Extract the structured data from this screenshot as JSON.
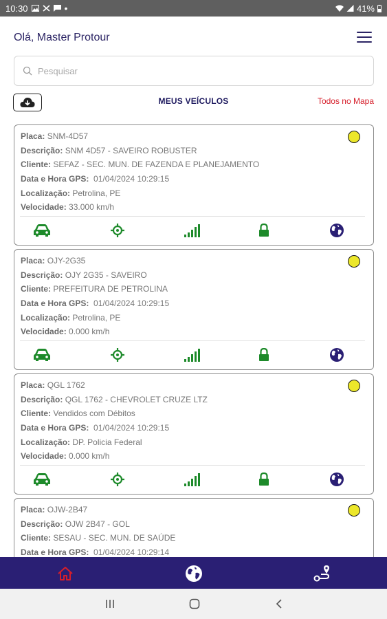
{
  "status_bar": {
    "time": "10:30",
    "battery": "41%"
  },
  "header": {
    "greeting": "Olá, Master Protour"
  },
  "search": {
    "placeholder": "Pesquisar"
  },
  "section": {
    "title": "MEUS VEÍCULOS",
    "map_link": "Todos no Mapa"
  },
  "labels": {
    "plate": "Placa:",
    "description": "Descrição:",
    "client": "Cliente:",
    "gps_time": "Data e Hora GPS:",
    "location": "Localização:",
    "speed": "Velocidade:"
  },
  "vehicles": [
    {
      "plate": "SNM-4D57",
      "description": "SNM 4D57 - SAVEIRO ROBUSTER",
      "client": "SEFAZ - SEC. MUN. DE FAZENDA E PLANEJAMENTO",
      "gps_time": "01/04/2024 10:29:15",
      "location": "Petrolina, PE",
      "speed": "33.000 km/h"
    },
    {
      "plate": "OJY-2G35",
      "description": "OJY 2G35 - SAVEIRO",
      "client": "PREFEITURA DE PETROLINA",
      "gps_time": "01/04/2024 10:29:15",
      "location": "Petrolina, PE",
      "speed": "0.000 km/h"
    },
    {
      "plate": "QGL 1762",
      "description": "QGL 1762 - CHEVROLET CRUZE LTZ",
      "client": "Vendidos com Débitos",
      "gps_time": "01/04/2024 10:29:15",
      "location": "DP. Policia Federal",
      "speed": "0.000 km/h"
    },
    {
      "plate": "OJW-2B47",
      "description": "OJW 2B47 - GOL",
      "client": "SESAU - SEC. MUN. DE SAÚDE",
      "gps_time": "01/04/2024 10:29:14",
      "location": "",
      "speed": ""
    }
  ],
  "icons": {
    "card_actions": [
      "car-icon",
      "crosshair-icon",
      "signal-icon",
      "lock-icon",
      "globe-icon"
    ],
    "nav": [
      "home-icon",
      "globe-icon",
      "route-icon"
    ]
  },
  "colors": {
    "brand": "#2a1f74",
    "accent_red": "#d61e2a",
    "action_green": "#1d8a2a",
    "status_yellow": "#ece72a",
    "globe_blue": "#2a1f74"
  }
}
